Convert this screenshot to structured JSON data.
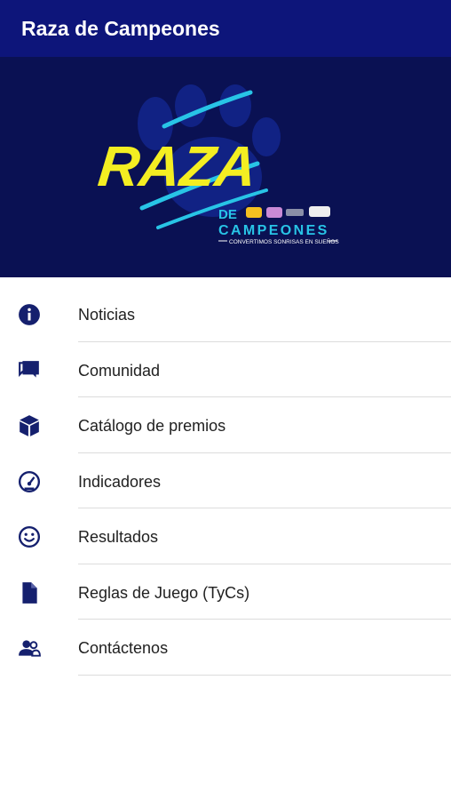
{
  "appbar": {
    "title": "Raza de Campeones"
  },
  "banner": {
    "logo_word": "RAZA",
    "logo_de": "DE",
    "logo_campeones": "CAMPEONES",
    "tagline": "CONVERTIMOS SONRISAS EN SUEÑOS"
  },
  "menu": {
    "items": [
      {
        "label": "Noticias",
        "icon": "info-icon"
      },
      {
        "label": "Comunidad",
        "icon": "chat-icon"
      },
      {
        "label": "Catálogo de premios",
        "icon": "box-icon"
      },
      {
        "label": "Indicadores",
        "icon": "speedometer-icon"
      },
      {
        "label": "Resultados",
        "icon": "smiley-icon"
      },
      {
        "label": "Reglas de Juego (TyCs)",
        "icon": "document-icon"
      },
      {
        "label": "Contáctenos",
        "icon": "contacts-icon"
      }
    ]
  },
  "colors": {
    "appbar": "#0d157a",
    "banner_bg": "#0a1153",
    "logo_yellow": "#f4ee22",
    "logo_cyan": "#28c4e6",
    "icon": "#15206e"
  }
}
